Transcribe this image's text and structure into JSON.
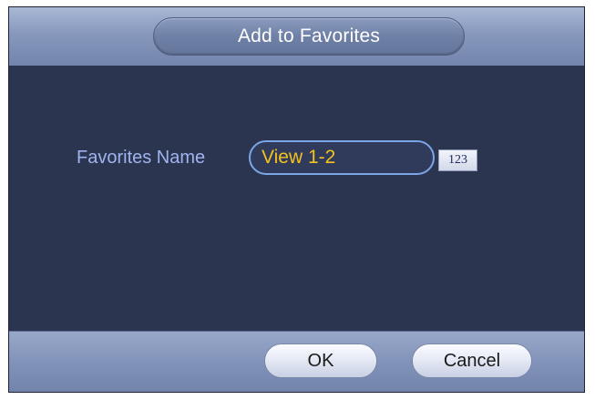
{
  "dialog": {
    "title": "Add to Favorites",
    "field_label": "Favorites Name",
    "name_value": "View 1-2",
    "ime_label": "123",
    "ok_label": "OK",
    "cancel_label": "Cancel"
  },
  "colors": {
    "background": "#2c3550",
    "label": "#9fb4ee",
    "input_text": "#f2c21e",
    "input_border": "#7aa6e6",
    "bar": "#8798bd"
  }
}
